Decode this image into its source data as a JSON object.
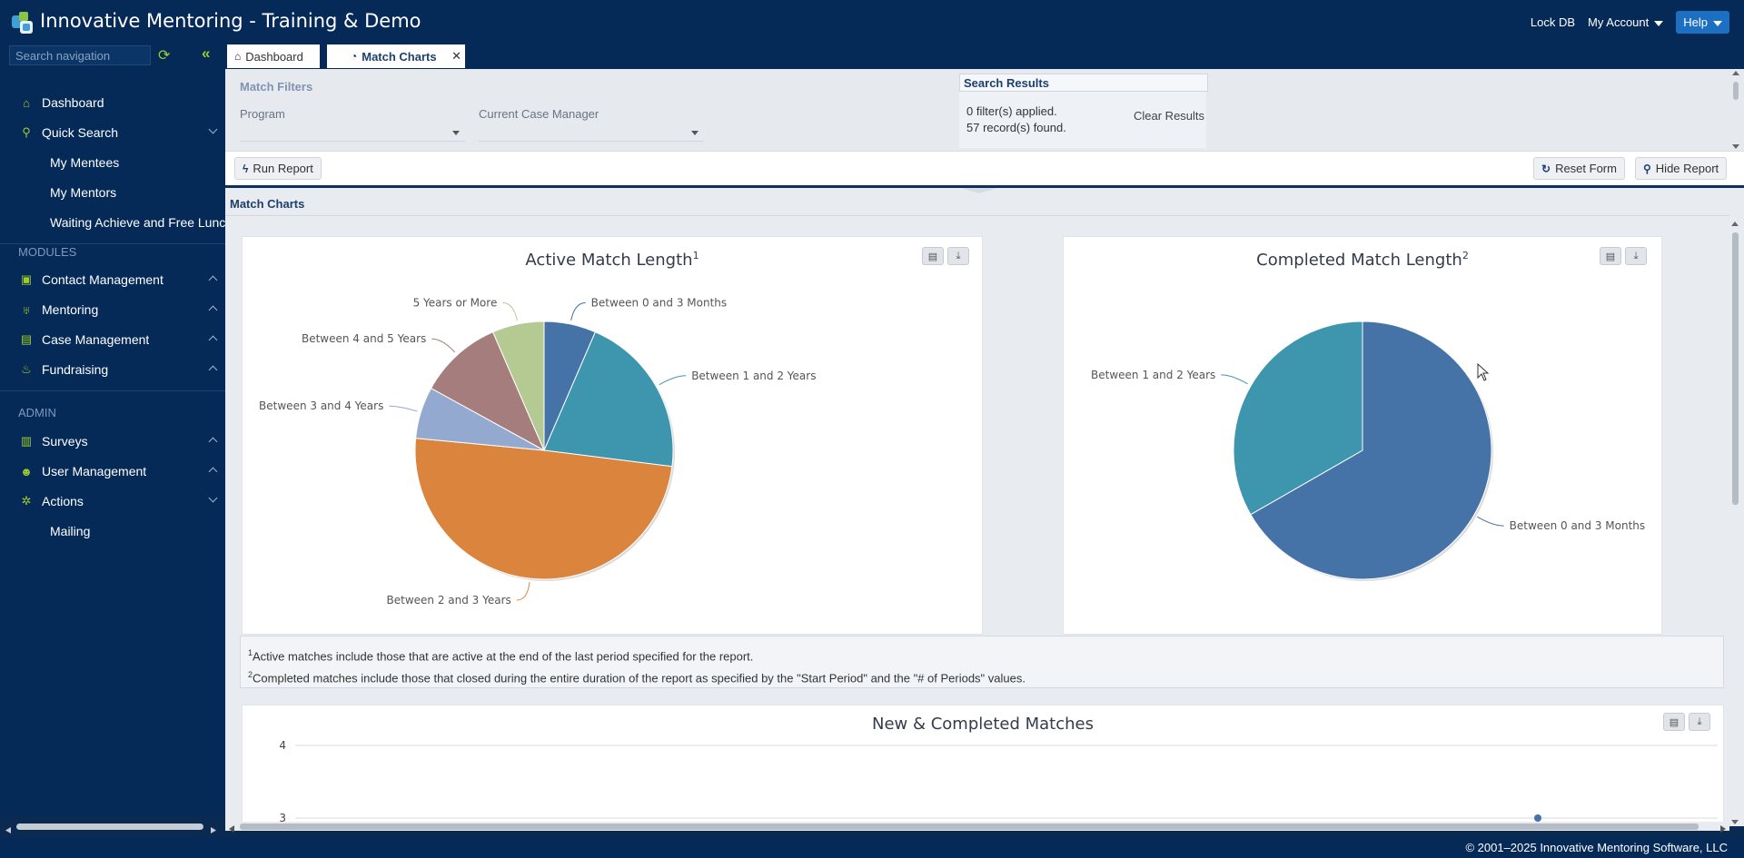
{
  "app": {
    "title": "Innovative Mentoring - Training & Demo",
    "lock_db": "Lock DB",
    "my_account": "My Account",
    "help": "Help"
  },
  "sidebar": {
    "search_placeholder": "Search navigation",
    "items": [
      {
        "label": "Dashboard",
        "icon": "home-icon"
      },
      {
        "label": "Quick Search",
        "icon": "search-icon"
      },
      {
        "label": "My Mentees"
      },
      {
        "label": "My Mentors"
      },
      {
        "label": "Waiting Achieve and Free Lunch"
      }
    ],
    "modules_header": "MODULES",
    "modules": [
      {
        "label": "Contact Management",
        "icon": "address-book-icon"
      },
      {
        "label": "Mentoring",
        "icon": "handshake-icon"
      },
      {
        "label": "Case Management",
        "icon": "briefcase-icon"
      },
      {
        "label": "Fundraising",
        "icon": "donate-icon"
      }
    ],
    "admin_header": "ADMIN",
    "admin": [
      {
        "label": "Surveys",
        "icon": "clipboard-icon"
      },
      {
        "label": "User Management",
        "icon": "user-cog-icon"
      },
      {
        "label": "Actions",
        "icon": "gear-icon"
      },
      {
        "label": "Mailing"
      }
    ]
  },
  "tabs": {
    "dashboard": "Dashboard",
    "match_charts": "Match Charts"
  },
  "filters": {
    "title": "Match Filters",
    "program_label": "Program",
    "program_value": "",
    "case_manager_label": "Current Case Manager",
    "case_manager_value": ""
  },
  "results": {
    "title": "Search Results",
    "filters_applied": "0 filter(s) applied.",
    "records_found": "57 record(s) found.",
    "clear": "Clear Results"
  },
  "toolbar": {
    "run_report": "Run Report",
    "reset_form": "Reset Form",
    "hide_report": "Hide Report"
  },
  "section_title": "Match Charts",
  "charts": {
    "active_title": "Active Match Length",
    "active_sup": "1",
    "completed_title": "Completed Match Length",
    "completed_sup": "2",
    "new_completed_title": "New & Completed Matches"
  },
  "colors": {
    "blue": "#4572a7",
    "teal": "#3d96ae",
    "lightblue": "#93a9cf",
    "mauve": "#a47d7c",
    "green": "#b5ca92",
    "orange": "#db843d"
  },
  "chart_data": [
    {
      "type": "pie",
      "title": "Active Match Length",
      "slices": [
        {
          "name": "Between 0 and 3 Months",
          "value": 6.5
        },
        {
          "name": "Between 1 and 2 Years",
          "value": 20.5
        },
        {
          "name": "Between 2 and 3 Years",
          "value": 49.5
        },
        {
          "name": "Between 3 and 4 Years",
          "value": 6.5
        },
        {
          "name": "Between 4 and 5 Years",
          "value": 10.5
        },
        {
          "name": "5 Years or More",
          "value": 6.5
        }
      ]
    },
    {
      "type": "pie",
      "title": "Completed Match Length",
      "slices": [
        {
          "name": "Between 0 and 3 Months",
          "value": 66.7
        },
        {
          "name": "Between 1 and 2 Years",
          "value": 33.3
        }
      ]
    },
    {
      "type": "line",
      "title": "New & Completed Matches",
      "y_ticks": [
        "4",
        "3"
      ]
    }
  ],
  "footnotes": {
    "n1_sup": "1",
    "n1": "Active matches include those that are active at the end of the last period specified for the report.",
    "n2_sup": "2",
    "n2": "Completed matches include those that closed during the entire duration of the report as specified by the \"Start Period\" and the \"# of Periods\" values."
  },
  "footer": {
    "copyright": "© 2001–2025 Innovative Mentoring Software, LLC"
  }
}
